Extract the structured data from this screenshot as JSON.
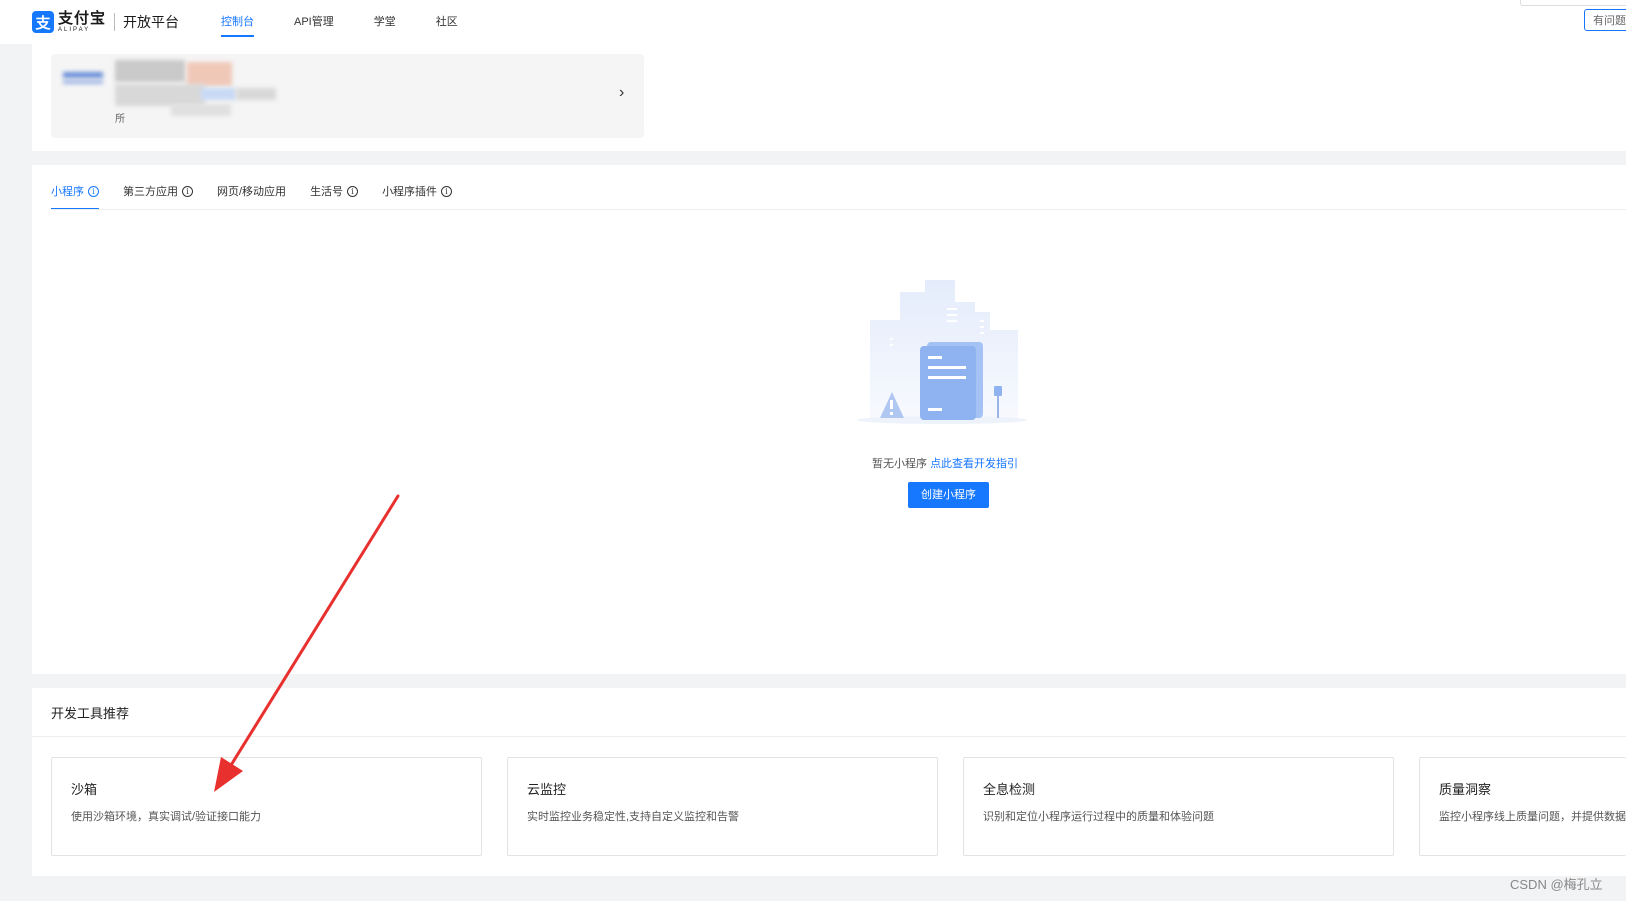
{
  "header": {
    "logo_mark": "支",
    "brand": "支付宝",
    "brand_en": "ALIPAY",
    "platform": "开放平台",
    "nav": [
      {
        "label": "控制台",
        "active": true
      },
      {
        "label": "API管理",
        "active": false
      },
      {
        "label": "学堂",
        "active": false
      },
      {
        "label": "社区",
        "active": false
      }
    ],
    "help_label": "有问题"
  },
  "account": {
    "label": "所",
    "arrow": "›"
  },
  "tabs": [
    {
      "label": "小程序",
      "info": true,
      "active": true
    },
    {
      "label": "第三方应用",
      "info": true,
      "active": false
    },
    {
      "label": "网页/移动应用",
      "info": false,
      "active": false
    },
    {
      "label": "生活号",
      "info": true,
      "active": false
    },
    {
      "label": "小程序插件",
      "info": true,
      "active": false
    }
  ],
  "empty_state": {
    "text": "暂无小程序",
    "link": "点此查看开发指引",
    "button": "创建小程序",
    "illustration_icon": "empty-document-icon"
  },
  "tools": {
    "title": "开发工具推荐",
    "items": [
      {
        "title": "沙箱",
        "desc": "使用沙箱环境，真实调试/验证接口能力"
      },
      {
        "title": "云监控",
        "desc": "实时监控业务稳定性,支持自定义监控和告警"
      },
      {
        "title": "全息检测",
        "desc": "识别和定位小程序运行过程中的质量和体验问题"
      },
      {
        "title": "质量洞察",
        "desc": "监控小程序线上质量问题，并提供数据"
      }
    ]
  },
  "annotation": {
    "color": "#e8302f",
    "arrow_icon": "red-arrow-annotation"
  },
  "watermark": "CSDN @梅孔立",
  "colors": {
    "accent": "#1677ff",
    "background": "#f2f3f5"
  }
}
